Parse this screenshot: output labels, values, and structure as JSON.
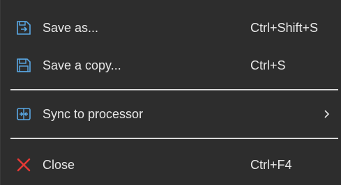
{
  "menu": {
    "items": [
      {
        "label": "Save as...",
        "shortcut": "Ctrl+Shift+S",
        "icon": "save-as-icon"
      },
      {
        "label": "Save a copy...",
        "shortcut": "Ctrl+S",
        "icon": "save-copy-icon"
      },
      {
        "label": "Sync to processor",
        "shortcut": "",
        "icon": "sync-icon",
        "has_submenu": true
      },
      {
        "label": "Close",
        "shortcut": "Ctrl+F4",
        "icon": "close-icon"
      }
    ]
  },
  "colors": {
    "background": "#2d2d2d",
    "text": "#e8e8e8",
    "icon_blue": "#5aa9e6",
    "close_red": "#e53935",
    "separator": "#d9d9d9"
  }
}
